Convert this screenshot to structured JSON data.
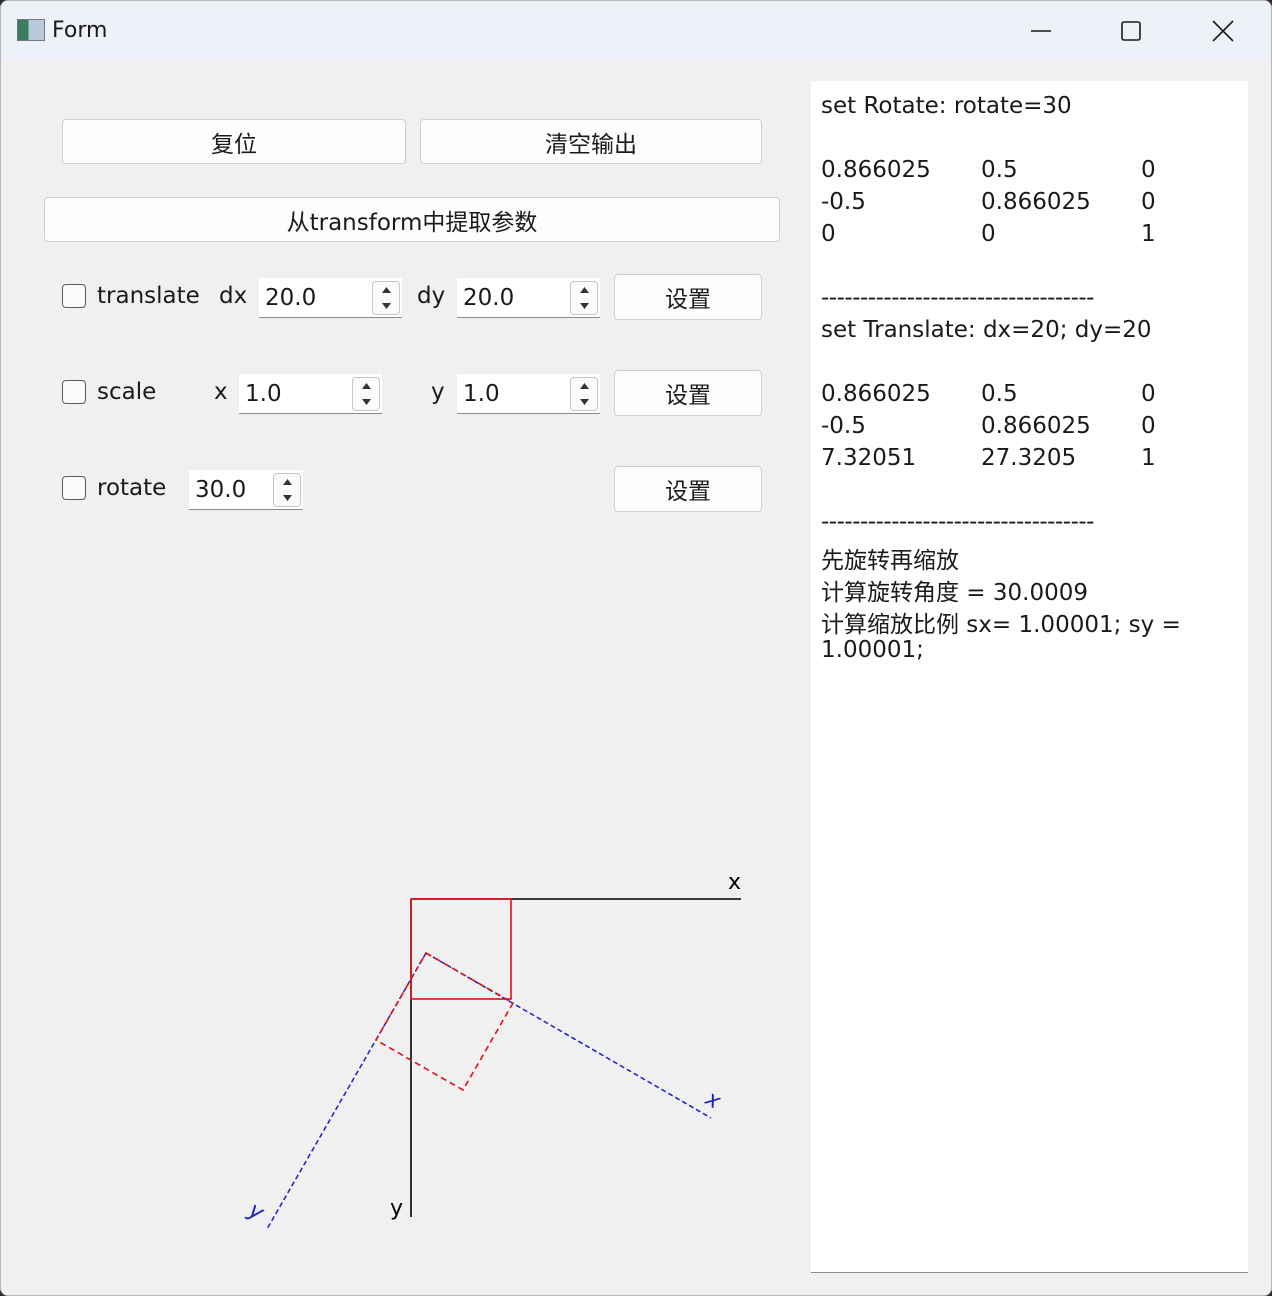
{
  "window": {
    "title": "Form",
    "icons": {
      "app": "app-icon",
      "minimize": "minimize-icon",
      "maximize": "maximize-icon",
      "close": "close-icon"
    }
  },
  "buttons": {
    "reset": "复位",
    "clear_output": "清空输出",
    "extract": "从transform中提取参数",
    "set": "设置"
  },
  "controls": {
    "translate": {
      "label": "translate",
      "checked": false,
      "dx_label": "dx",
      "dx": "20.0",
      "dy_label": "dy",
      "dy": "20.0"
    },
    "scale": {
      "label": "scale",
      "checked": false,
      "x_label": "x",
      "x": "1.0",
      "y_label": "y",
      "y": "1.0"
    },
    "rotate": {
      "label": "rotate",
      "checked": false,
      "value": "30.0"
    }
  },
  "output": {
    "block1_title": "set Rotate: rotate=30",
    "matrix1": [
      [
        "0.866025",
        "0.5",
        "0"
      ],
      [
        "-0.5",
        "0.866025",
        "0"
      ],
      [
        "0",
        "0",
        "1"
      ]
    ],
    "separator": "-----------------------------------",
    "block2_title": "set Translate: dx=20; dy=20",
    "matrix2": [
      [
        "0.866025",
        "0.5",
        "0"
      ],
      [
        "-0.5",
        "0.866025",
        "0"
      ],
      [
        "7.32051",
        "27.3205",
        "1"
      ]
    ],
    "result1": "先旋转再缩放",
    "result2": "计算旋转角度 = 30.0009",
    "result3": "计算缩放比例 sx= 1.00001;  sy =",
    "result4": "1.00001;"
  },
  "drawing": {
    "axis_x_label": "x",
    "axis_y_label": "y",
    "rotated_x_label": "x",
    "rotated_y_label": "y",
    "colors": {
      "axis": "#000000",
      "rect": "#e0101b",
      "rotated_axis": "#1d1dc8"
    }
  }
}
